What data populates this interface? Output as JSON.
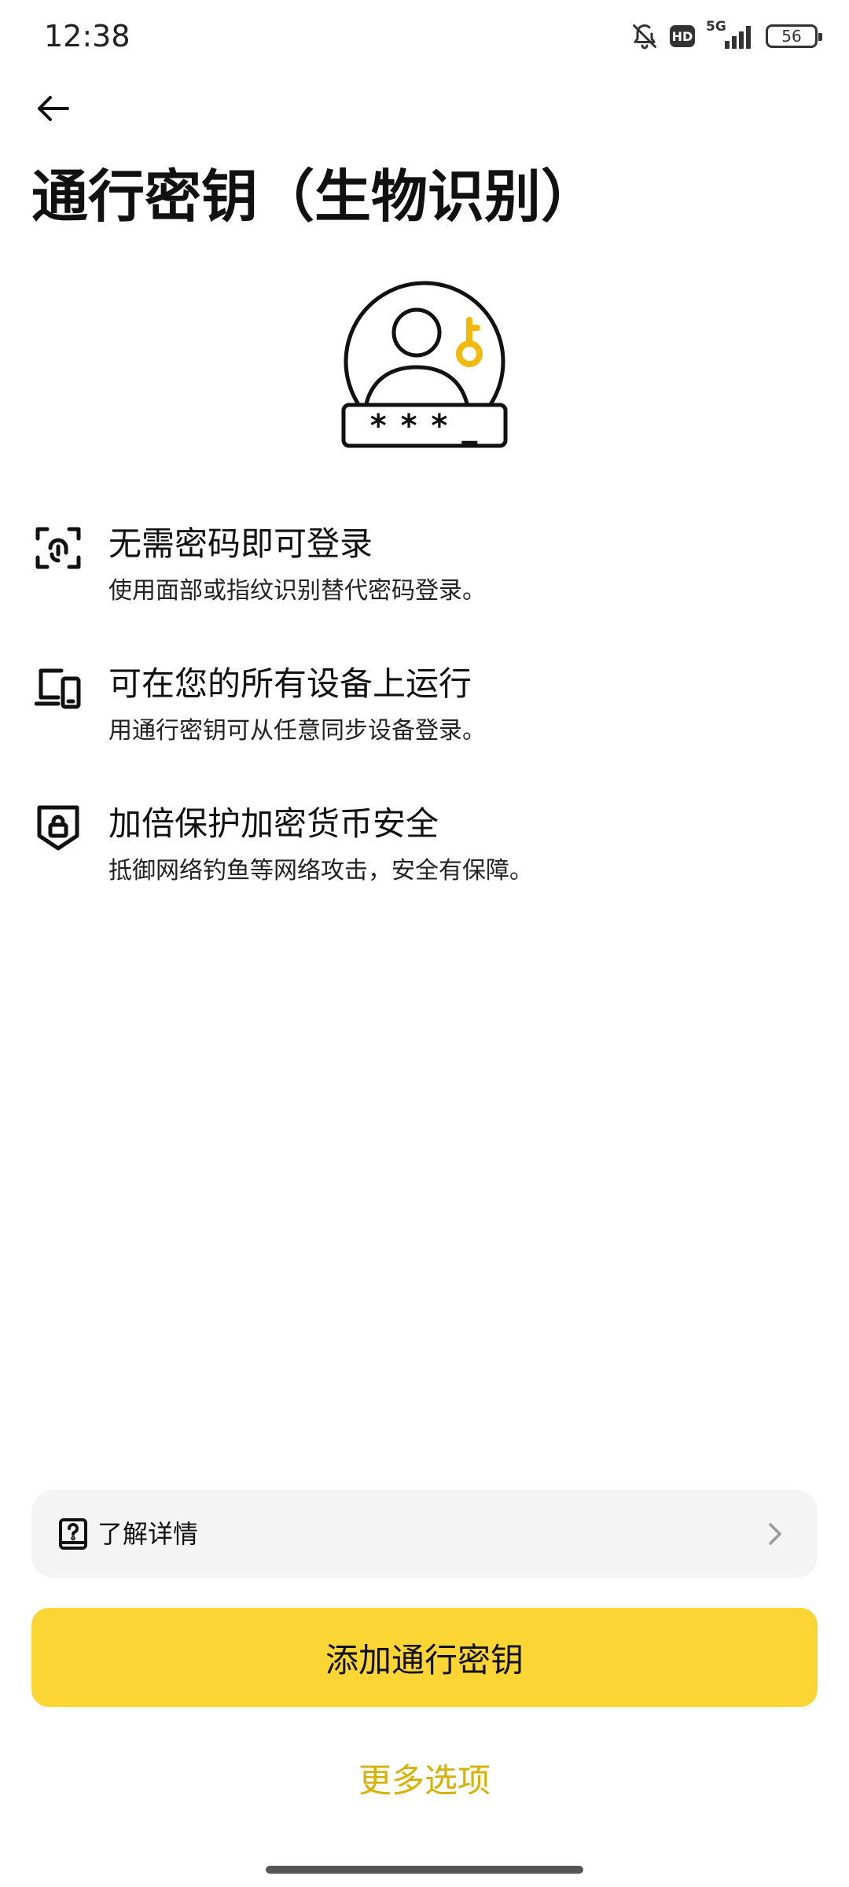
{
  "status_bar": {
    "time": "12:38",
    "network": "5G",
    "hd_badge": "HD",
    "battery": "56"
  },
  "header": {
    "title": "通行密钥（生物识别）"
  },
  "hero": {
    "password_mask": "* * * _"
  },
  "features": [
    {
      "icon": "face-scan-icon",
      "heading": "无需密码即可登录",
      "description": "使用面部或指纹识别替代密码登录。"
    },
    {
      "icon": "devices-icon",
      "heading": "可在您的所有设备上运行",
      "description": "用通行密钥可从任意同步设备登录。"
    },
    {
      "icon": "shield-lock-icon",
      "heading": "加倍保护加密货币安全",
      "description": "抵御网络钓鱼等网络攻击，安全有保障。"
    }
  ],
  "learn_more": {
    "label": "了解详情"
  },
  "primary_button": {
    "label": "添加通行密钥"
  },
  "more_options": {
    "label": "更多选项"
  },
  "colors": {
    "accent": "#fbd534",
    "accent_text": "#d8b000",
    "key_icon": "#f0b90b"
  }
}
